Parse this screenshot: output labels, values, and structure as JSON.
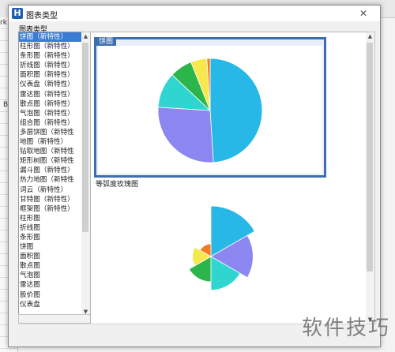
{
  "background_app": {
    "fragments": [
      "rk",
      "B"
    ]
  },
  "dialog": {
    "title": "图表类型",
    "close_glyph": "✕",
    "section_label": "图表类型",
    "chart_types": [
      "饼图（新特性）",
      "柱形图（新特性）",
      "条形图（新特性）",
      "折线图（新特性）",
      "面积图（新特性）",
      "仪表盘（新特性）",
      "雷达图（新特性）",
      "散点图（新特性）",
      "气泡图（新特性）",
      "组合图（新特性）",
      "多层饼图（新特性",
      "地图（新特性）",
      "钻取地图（新特性",
      "矩形树图（新特性",
      "漏斗图（新特性）",
      "热力地图（新特性",
      "词云（新特性）",
      "甘特图（新特性）",
      "框架图（新特性）",
      "柱形图",
      "折线图",
      "条形图",
      "饼图",
      "面积图",
      "散点图",
      "气泡图",
      "雷达图",
      "股价图",
      "仪表盘"
    ],
    "selected_index": 0,
    "gallery": [
      {
        "title": "饼图",
        "selected": true
      },
      {
        "title": "等弧度玫瑰图",
        "selected": false
      },
      {
        "title": "",
        "selected": false
      }
    ],
    "colors": {
      "accent": "#3d6fb0",
      "pie": [
        "#27b8e8",
        "#8b86f0",
        "#2fd6d0",
        "#2cb54a",
        "#f7e94d",
        "#f57a22"
      ]
    }
  },
  "chart_data": [
    {
      "type": "pie",
      "values": [
        49,
        27,
        11,
        7,
        5,
        1
      ],
      "colors": [
        "#27b8e8",
        "#8b86f0",
        "#2fd6d0",
        "#2cb54a",
        "#f7e94d",
        "#f57a22"
      ]
    },
    {
      "type": "pie",
      "subtype": "rose-equal-angle",
      "title": "等弧度玫瑰图",
      "values": [
        60,
        50,
        40,
        30,
        22,
        15
      ],
      "colors": [
        "#27b8e8",
        "#8b86f0",
        "#2fd6d0",
        "#2cb54a",
        "#f7e94d",
        "#f57a22"
      ]
    }
  ],
  "watermark": "软件技巧"
}
